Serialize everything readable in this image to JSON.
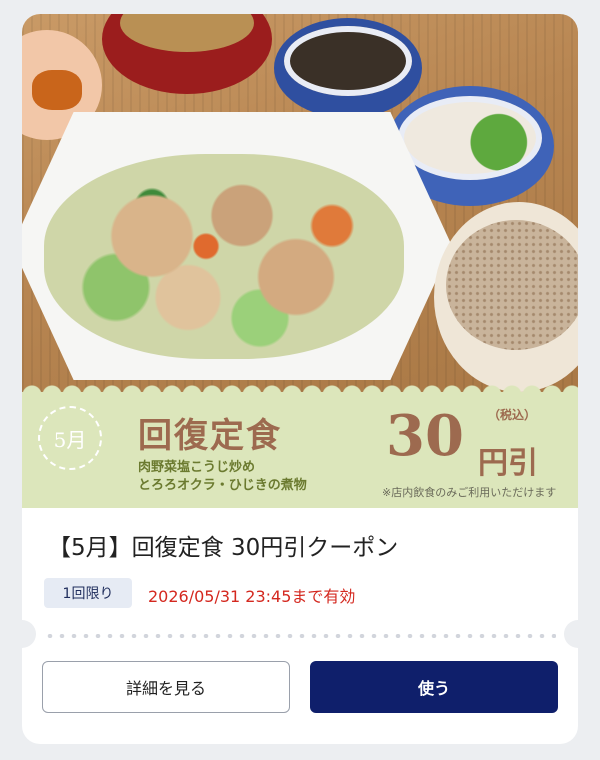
{
  "coupon": {
    "month_badge": "5月",
    "menu_title": "回復定食",
    "menu_items": [
      "肉野菜塩こうじ炒め",
      "とろろオクラ・ひじきの煮物"
    ],
    "discount_amount": "30",
    "discount_suffix": "円引",
    "tax_label": "（税込）",
    "note": "※店内飲食のみご利用いただけます",
    "title": "【5月】回復定食 30円引クーポン",
    "usage_limit": "1回限り",
    "validity": "2026/05/31 23:45まで有効"
  },
  "buttons": {
    "detail": "詳細を見る",
    "use": "使う"
  },
  "colors": {
    "banner_bg": "#dce6bb",
    "accent_brown": "#9d6a4f",
    "primary_navy": "#0f1f6b",
    "validity_red": "#d4281f"
  }
}
